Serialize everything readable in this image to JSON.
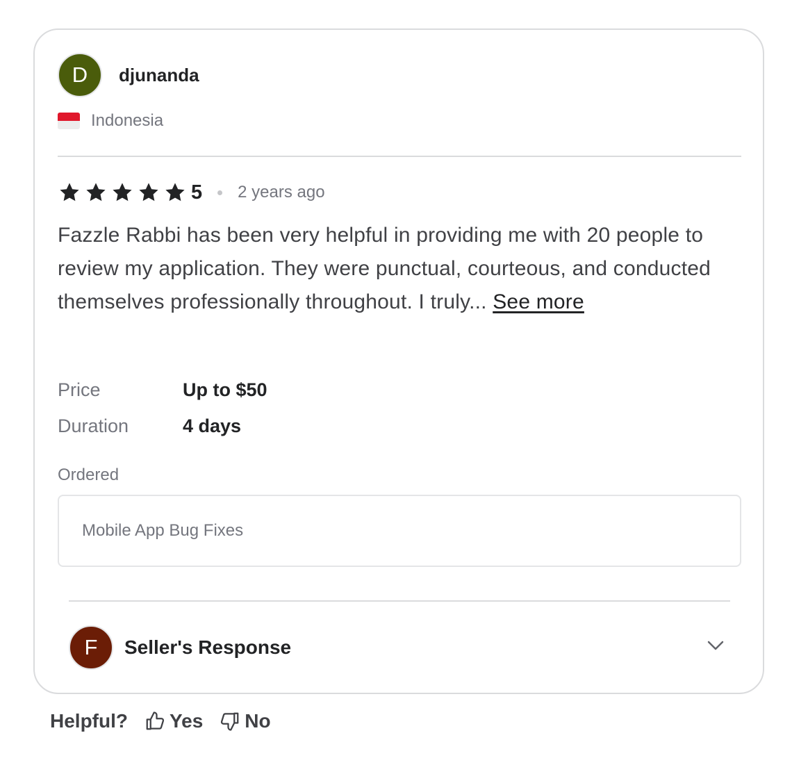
{
  "reviewer": {
    "avatar_letter": "D",
    "username": "djunanda",
    "country": "Indonesia"
  },
  "rating": {
    "stars": 5,
    "value": "5",
    "time_ago": "2 years ago"
  },
  "review": {
    "text": "Fazzle Rabbi has been very helpful in providing me with 20 people to review my application. They were punctual, courteous, and conducted themselves professionally throughout. I truly... ",
    "see_more": "See more"
  },
  "details": {
    "price_label": "Price",
    "price_value": "Up to $50",
    "duration_label": "Duration",
    "duration_value": "4 days"
  },
  "ordered": {
    "label": "Ordered",
    "value": "Mobile App Bug Fixes"
  },
  "seller_response": {
    "avatar_letter": "F",
    "title": "Seller's Response"
  },
  "helpful": {
    "label": "Helpful?",
    "yes": "Yes",
    "no": "No"
  },
  "colors": {
    "reviewer_avatar": "#4a5c0b",
    "seller_avatar": "#6b1d06",
    "star": "#222325"
  },
  "icons": [
    "star-icon",
    "flag-indonesia-icon",
    "chevron-down-icon",
    "thumbs-up-icon",
    "thumbs-down-icon"
  ]
}
